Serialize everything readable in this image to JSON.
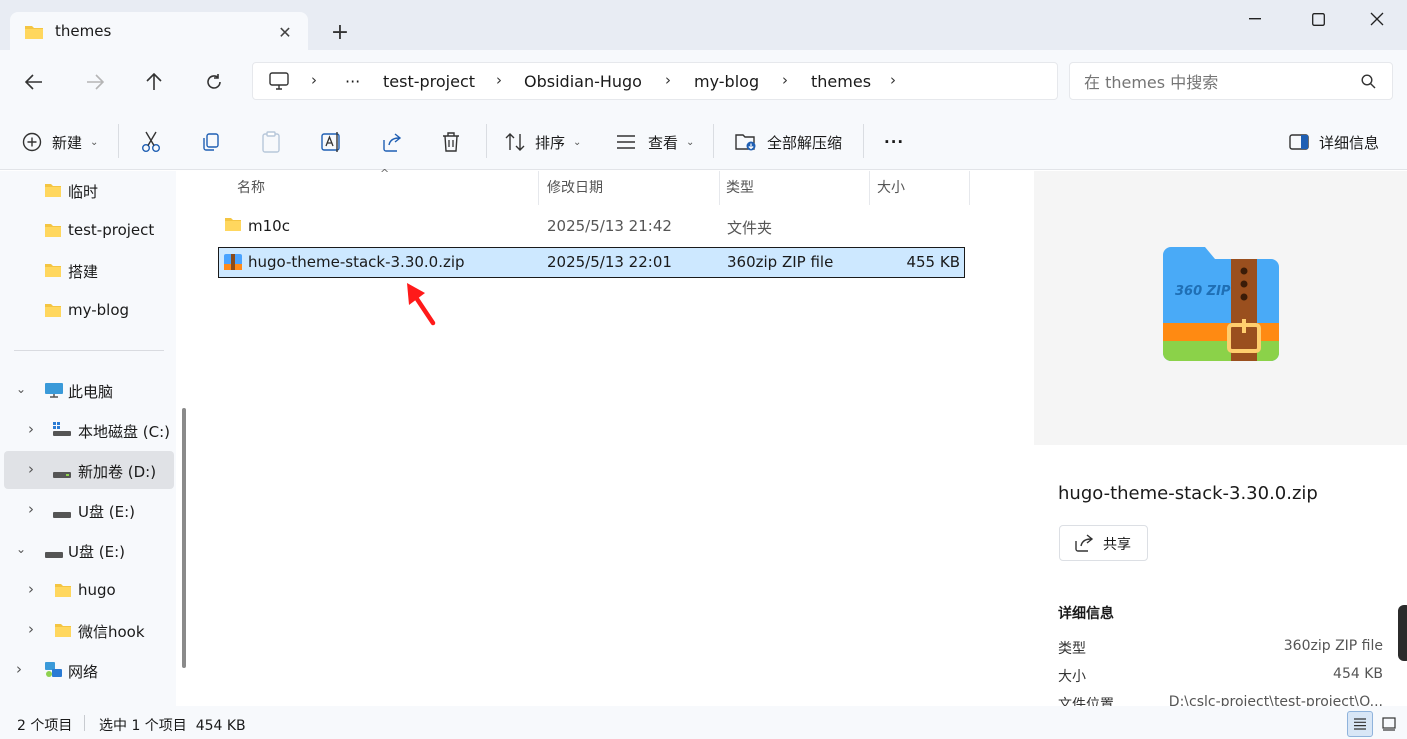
{
  "window": {
    "tab_title": "themes",
    "new_tab": "+"
  },
  "address": {
    "crumbs": [
      "test-project",
      "Obsidian-Hugo",
      "my-blog",
      "themes"
    ],
    "ellipsis": "···",
    "search_placeholder": "在 themes 中搜索"
  },
  "toolbar": {
    "new_label": "新建",
    "sort_label": "排序",
    "view_label": "查看",
    "extract_label": "全部解压缩",
    "more_label": "···",
    "details_label": "详细信息"
  },
  "sidebar": {
    "quick": [
      "临时",
      "test-project",
      "搭建",
      "my-blog"
    ],
    "this_pc": "此电脑",
    "drive_c": "本地磁盘 (C:)",
    "drive_d": "新加卷 (D:)",
    "drive_e": "U盘 (E:)",
    "usb": "U盘 (E:)",
    "usb_children": [
      "hugo",
      "微信hook"
    ],
    "network": "网络"
  },
  "filelist": {
    "columns": {
      "name": "名称",
      "modified": "修改日期",
      "type": "类型",
      "size": "大小"
    },
    "rows": [
      {
        "name": "m10c",
        "modified": "2025/5/13 21:42",
        "type": "文件夹",
        "size": ""
      },
      {
        "name": "hugo-theme-stack-3.30.0.zip",
        "modified": "2025/5/13 22:01",
        "type": "360zip ZIP file",
        "size": "455 KB"
      }
    ]
  },
  "preview": {
    "file_name": "hugo-theme-stack-3.30.0.zip",
    "share_label": "共享",
    "details_title": "详细信息",
    "details": [
      {
        "key": "类型",
        "value": "360zip ZIP file"
      },
      {
        "key": "大小",
        "value": "454 KB"
      },
      {
        "key": "文件位置",
        "value": "D:\\cslc-project\\test-project\\O..."
      }
    ],
    "logo_text": "360 ZIP"
  },
  "status": {
    "count": "2 个项目",
    "selection": "选中 1 个项目  454 KB"
  },
  "colors": {
    "accent": "#0067c0",
    "selection_bg": "#cde8ff",
    "annotation_arrow": "#ff1a1a"
  }
}
